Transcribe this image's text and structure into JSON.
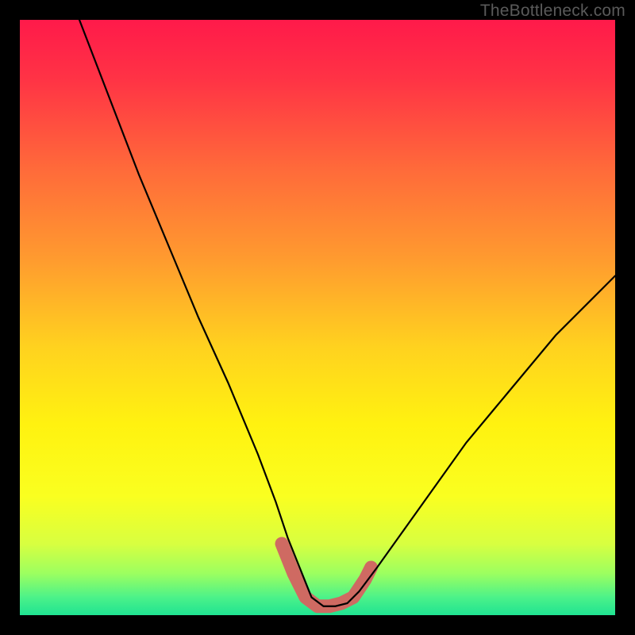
{
  "watermark": "TheBottleneck.com",
  "chart_data": {
    "type": "line",
    "title": "",
    "xlabel": "",
    "ylabel": "",
    "xlim": [
      0,
      100
    ],
    "ylim": [
      0,
      100
    ],
    "description": "Bottleneck percentage curve: a V-shaped black line over a vertical rainbow gradient (red at top through orange/yellow to green at bottom). The curve dips to near-zero around x≈48–56, with a thick salmon highlight segment marking the low-bottleneck region near the trough.",
    "series": [
      {
        "name": "bottleneck-curve",
        "x": [
          10,
          15,
          20,
          25,
          30,
          35,
          40,
          43,
          45,
          47,
          49,
          51,
          53,
          55,
          57,
          60,
          65,
          70,
          75,
          80,
          85,
          90,
          95,
          100
        ],
        "y": [
          100,
          87,
          74,
          62,
          50,
          39,
          27,
          19,
          13,
          8,
          3,
          1.5,
          1.5,
          2,
          4,
          8,
          15,
          22,
          29,
          35,
          41,
          47,
          52,
          57
        ]
      }
    ],
    "highlight_segment": {
      "name": "optimal-range",
      "color": "#cf6a62",
      "x": [
        44,
        46,
        48,
        50,
        52,
        54,
        56,
        58,
        59
      ],
      "y": [
        12,
        7,
        3,
        1.5,
        1.5,
        2,
        3,
        6,
        8
      ]
    },
    "gradient_stops": [
      {
        "offset": 0.0,
        "color": "#ff1a4a"
      },
      {
        "offset": 0.1,
        "color": "#ff3345"
      },
      {
        "offset": 0.25,
        "color": "#ff6a3a"
      },
      {
        "offset": 0.4,
        "color": "#ff9a2f"
      },
      {
        "offset": 0.55,
        "color": "#ffd21f"
      },
      {
        "offset": 0.68,
        "color": "#fff210"
      },
      {
        "offset": 0.8,
        "color": "#faff20"
      },
      {
        "offset": 0.88,
        "color": "#d8ff40"
      },
      {
        "offset": 0.93,
        "color": "#9cff60"
      },
      {
        "offset": 0.97,
        "color": "#4cf289"
      },
      {
        "offset": 1.0,
        "color": "#20e392"
      }
    ]
  }
}
